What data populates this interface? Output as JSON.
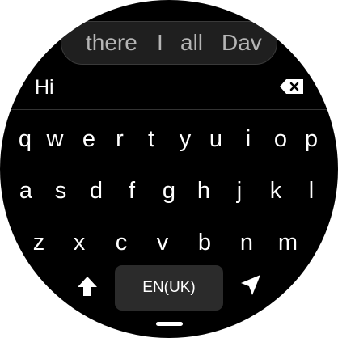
{
  "suggestions": [
    "there",
    "I",
    "all",
    "Dav"
  ],
  "input": {
    "text": "Hi"
  },
  "keyboard": {
    "row1": [
      "q",
      "w",
      "e",
      "r",
      "t",
      "y",
      "u",
      "i",
      "o",
      "p"
    ],
    "row2": [
      "a",
      "s",
      "d",
      "f",
      "g",
      "h",
      "j",
      "k",
      "l"
    ],
    "row3": [
      "z",
      "x",
      "c",
      "v",
      "b",
      "n",
      "m"
    ],
    "language_label": "EN(UK)"
  },
  "icons": {
    "backspace": "backspace-icon",
    "shift": "shift-arrow-icon",
    "send": "send-icon"
  },
  "colors": {
    "background": "#000000",
    "key_text": "#ffffff",
    "suggestion_text": "#b5b5b5",
    "suggestion_bg": "#1f1f1f",
    "language_bg": "#2b2b2b"
  }
}
